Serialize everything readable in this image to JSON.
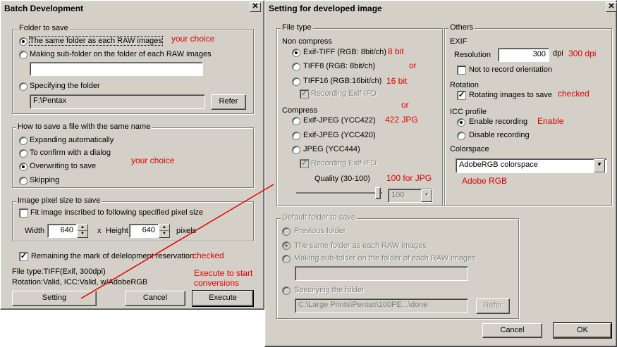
{
  "batch": {
    "title": "Batch Development",
    "folder_group": "Folder to save",
    "folder_opt1": "The same folder as each RAW images",
    "folder_opt2": "Making sub-folder on the folder of each RAW images",
    "subfolder_value": "",
    "folder_opt3": "Specifying the folder",
    "folder_path": "F:\\Pentax",
    "refer": "Refer",
    "samename_group": "How to save a file with the same name",
    "samename_opt1": "Expanding automatically",
    "samename_opt2": "To confirm with a dialog",
    "samename_opt3": "Overwriting to save",
    "samename_opt4": "Skipping",
    "pixel_group": "Image pixel size to save",
    "fit_label": "Fit image inscribed to following specified pixel size",
    "width_label": "Width",
    "width_value": "640",
    "x_label": "x",
    "height_label": "Height",
    "height_value": "640",
    "pixels_label": "pixels",
    "remaining_label": "Remaining the mark of delelopment reservation",
    "status_line1": "File type:TIFF(Exif, 300dpi)",
    "status_line2": "Rotation:Valid, ICC:Valid, w/AdobeRGB",
    "setting_btn": "Setting",
    "cancel_btn": "Cancel",
    "execute_btn": "Execute"
  },
  "setting": {
    "title": "Setting for developed image",
    "filetype_group": "File type",
    "noncompress": "Non compress",
    "exif_tiff": "Exif-TIFF  (RGB: 8bit/ch)",
    "tiff8": "TIFF8  (RGB: 8bit/ch)",
    "tiff16": "TIFF16  (RGB:16bit/ch)",
    "rec_exif_ifd1": "Recording Exif-IFD",
    "compress": "Compress",
    "exif_jpeg422": "Exif-JPEG  (YCC422)",
    "exif_jpeg420": "Exif-JPEG  (YCC420)",
    "jpeg444": "JPEG  (YCC444)",
    "rec_exif_ifd2": "Recording Exif-IFD",
    "quality_label": "Quality (30-100)",
    "quality_value": "100",
    "others_group": "Others",
    "exif_label": "EXIF",
    "resolution_label": "Resolution",
    "resolution_value": "300",
    "dpi_label": "dpi",
    "not_record_orientation": "Not to record orientation",
    "rotation_label": "Rotation",
    "rotating_label": "Rotating images to save",
    "icc_label": "ICC profile",
    "enable_recording": "Enable recording",
    "disable_recording": "Disable recording",
    "colorspace_label": "Colorspace",
    "colorspace_value": "AdobeRGB colorspace",
    "default_folder_group": "Default folder to save",
    "prev_folder": "Previous folder",
    "same_folder": "The same folder as each RAW images",
    "sub_folder": "Making sub-folder on the folder of each RAW images",
    "sub_folder_value": "",
    "spec_folder": "Specifying the folder",
    "spec_folder_value": "C:\\Large Prints\\Pentax\\100PE...\\done",
    "refer": "Refer",
    "cancel_btn": "Cancel",
    "ok_btn": "OK"
  },
  "annotations": {
    "your_choice1": "your choice",
    "your_choice2": "your choice",
    "checked1": "checked",
    "execute_note": "Execute to start\nconversions",
    "bit8": "8 bit",
    "or1": "or",
    "bit16": "16 bit",
    "or2": "or",
    "jpg422": "422 JPG",
    "jpg100": "100 for JPG",
    "dpi300": "300 dpi",
    "checked2": "checked",
    "enable": "Enable",
    "adobe": "Adobe RGB"
  },
  "colors": {
    "annotation": "#e00000",
    "dialog_face": "#d4d0c8"
  }
}
